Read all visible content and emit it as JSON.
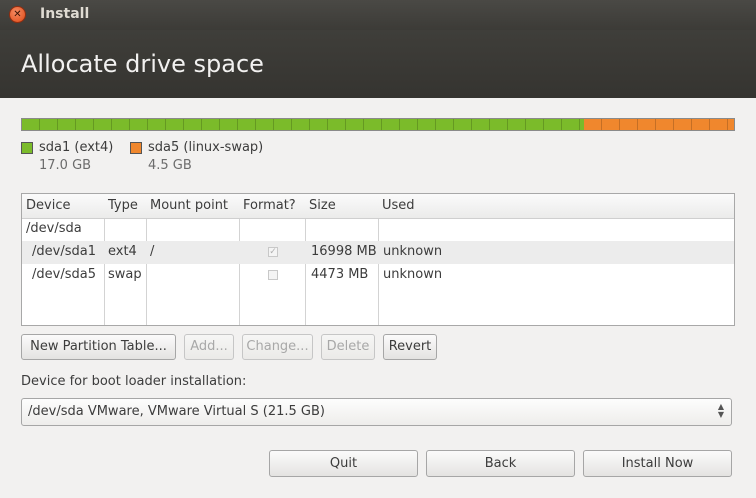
{
  "window": {
    "title": "Install",
    "close_icon": "close-icon"
  },
  "page": {
    "title": "Allocate drive space"
  },
  "partition_bar": {
    "segments": [
      {
        "name": "sda1 (ext4)",
        "size": "17.0 GB",
        "color": "#7bbb2a",
        "fraction": 0.79
      },
      {
        "name": "sda5 (linux-swap)",
        "size": "4.5 GB",
        "color": "#f0872d",
        "fraction": 0.21
      }
    ]
  },
  "table": {
    "columns": [
      "Device",
      "Type",
      "Mount point",
      "Format?",
      "Size",
      "Used"
    ],
    "rows": [
      {
        "device": "/dev/sda",
        "type": "",
        "mount": "",
        "format": null,
        "size": "",
        "used": ""
      },
      {
        "device": "/dev/sda1",
        "type": "ext4",
        "mount": "/",
        "format": true,
        "size": "16998 MB",
        "used": "unknown"
      },
      {
        "device": "/dev/sda5",
        "type": "swap",
        "mount": "",
        "format": false,
        "size": "4473 MB",
        "used": "unknown"
      }
    ]
  },
  "actions": {
    "new_table": "New Partition Table...",
    "add": "Add...",
    "change": "Change...",
    "delete": "Delete",
    "revert": "Revert"
  },
  "boot": {
    "label": "Device for boot loader installation:",
    "selected": "/dev/sda VMware, VMware Virtual S (21.5 GB)"
  },
  "footer": {
    "quit": "Quit",
    "back": "Back",
    "install": "Install Now"
  }
}
